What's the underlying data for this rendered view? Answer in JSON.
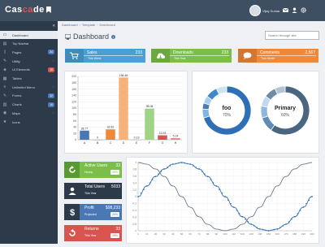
{
  "brand": {
    "name_start": "Cas",
    "name_accent": "ca",
    "name_end": "de"
  },
  "user": {
    "name": "Vijay Kumar"
  },
  "sidebar": {
    "items": [
      {
        "label": "Dashboard",
        "icon": "monitor-icon",
        "active": true
      },
      {
        "label": "Top Navbar",
        "icon": "window-icon"
      },
      {
        "label": "Pages",
        "icon": "file-icon",
        "badge": "34",
        "badge_color": "#4a78b5"
      },
      {
        "label": "Utility",
        "icon": "wrench-icon",
        "arrow": "›"
      },
      {
        "label": "UI Elements",
        "icon": "layers-icon",
        "badge": "15",
        "badge_color": "#d9534f"
      },
      {
        "label": "Tables",
        "icon": "table-icon"
      },
      {
        "label": "Unlimited Menu",
        "icon": "list-icon",
        "arrow": "›"
      },
      {
        "label": "Forms",
        "icon": "edit-icon",
        "badge": "32",
        "badge_color": "#4a78b5"
      },
      {
        "label": "Charts",
        "icon": "bar-chart-icon",
        "badge": "16",
        "badge_color": "#4a78b5"
      },
      {
        "label": "Maps",
        "icon": "map-icon",
        "arrow": "›"
      },
      {
        "label": "Icons",
        "icon": "star-icon"
      }
    ]
  },
  "breadcrumb": {
    "items": [
      "Dashboard",
      "Template"
    ],
    "current": "Dashboard"
  },
  "page": {
    "title": "Dashboard"
  },
  "search": {
    "placeholder": "Search through site"
  },
  "cards": [
    {
      "title": "Sales",
      "value": "233",
      "sub": "This Week",
      "color": "#4a9fd4",
      "icon": "cart-icon"
    },
    {
      "title": "Downloads",
      "value": "233",
      "sub": "This Year",
      "color": "#7bbf4a",
      "icon": "download-icon"
    },
    {
      "title": "Comments",
      "value": "2,567",
      "sub": "This Month",
      "color": "#f0883a",
      "icon": "comment-icon"
    }
  ],
  "chart_data": [
    {
      "type": "bar",
      "categories": [
        "A",
        "B",
        "C",
        "D",
        "E",
        "F",
        "G",
        "H"
      ],
      "values": [
        28.77,
        0,
        32.81,
        196.46,
        0.19,
        98.08,
        13.93,
        5.14
      ],
      "colors": [
        "#4a78b5",
        "#4a78b5",
        "#f0883a",
        "#f6b27a",
        "#7bbf4a",
        "#9fd484",
        "#d9534f",
        "#e78a8a"
      ],
      "ylim": [
        0,
        200
      ],
      "yticks": [
        0,
        20,
        40,
        60,
        80,
        100,
        120,
        140,
        160,
        180,
        200
      ]
    },
    {
      "type": "pie",
      "label": "foo",
      "value_text": "70%",
      "slices": [
        70,
        6,
        4,
        5,
        8,
        7
      ]
    },
    {
      "type": "pie",
      "label": "Primary",
      "value_text": "60%",
      "slices": [
        60,
        10,
        8,
        7,
        8,
        7
      ]
    },
    {
      "type": "line",
      "x_start": 0,
      "x_end": 200,
      "x_step": 10,
      "yticks": [
        -1.0,
        -0.8,
        -0.6,
        -0.4,
        -0.2,
        0,
        0.2,
        0.4,
        0.6,
        0.8,
        1.0
      ],
      "ylim": [
        -1,
        1
      ],
      "series": [
        {
          "values": [
            0.0,
            0.31,
            0.59,
            0.81,
            0.95,
            1.0,
            0.95,
            0.81,
            0.59,
            0.31,
            0.0,
            -0.31,
            -0.59,
            -0.81,
            -0.95,
            -1.0,
            -0.95,
            -0.81,
            -0.59,
            -0.31,
            0.0
          ],
          "color": "#2f6fb5"
        },
        {
          "values": [
            1.0,
            0.95,
            0.81,
            0.59,
            0.31,
            0.0,
            -0.31,
            -0.59,
            -0.81,
            -0.95,
            -1.0,
            -0.95,
            -0.81,
            -0.59,
            -0.31,
            0.0,
            0.31,
            0.59,
            0.81,
            0.95,
            1.0
          ],
          "color": "#6b7b8c"
        }
      ]
    }
  ],
  "mini_stats": [
    {
      "title": "Active Users",
      "value": "33",
      "sub": "Hourly",
      "pct": "29%",
      "color": "#7bbf4a",
      "icon_bg": "#5a9a33",
      "icon": "refresh-icon"
    },
    {
      "title": "Total Users",
      "value": "5033",
      "sub": "This Year",
      "pct": "",
      "color": "#2d3a49",
      "icon_bg": "#2d3a49",
      "icon": "user-icon"
    },
    {
      "title": "Profit",
      "value": "$98,233",
      "sub": "Projected",
      "pct": "29%",
      "color": "#4a78b5",
      "icon_bg": "#2d3a49",
      "icon": "dollar-icon"
    },
    {
      "title": "Returns",
      "value": "33",
      "sub": "This Year",
      "pct": "29%",
      "color": "#d9534f",
      "icon_bg": "#d9534f",
      "icon": "return-icon"
    }
  ]
}
